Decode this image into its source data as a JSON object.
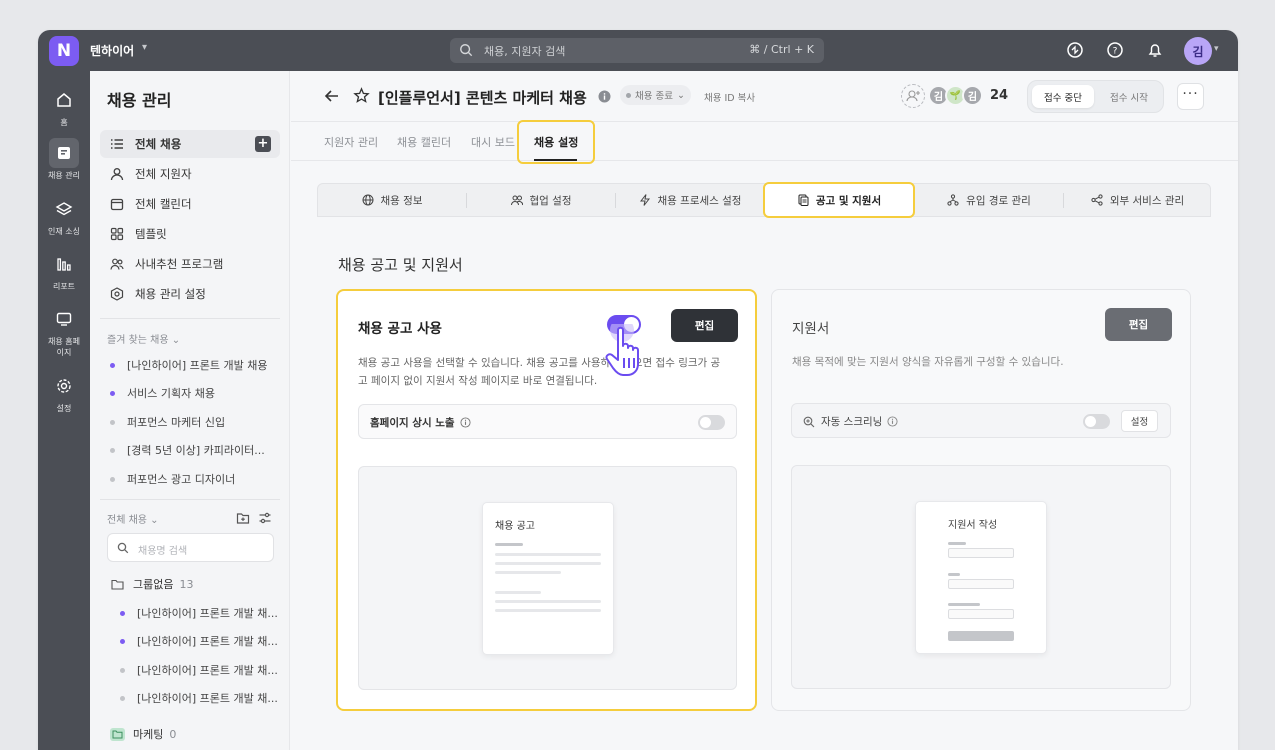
{
  "app": {
    "workspace": "텐하이어",
    "logo_letter": "N"
  },
  "search": {
    "placeholder": "채용, 지원자 검색",
    "shortcut": "⌘ / Ctrl + K"
  },
  "user": {
    "avatar": "김"
  },
  "rail": [
    {
      "label": "홈",
      "icon": "home-icon"
    },
    {
      "label": "채용 관리",
      "icon": "recruit-icon"
    },
    {
      "label": "인재 소싱",
      "icon": "layers-icon"
    },
    {
      "label": "리포트",
      "icon": "chart-icon"
    },
    {
      "label": "채용 홈페이지",
      "icon": "monitor-icon"
    },
    {
      "label": "설정",
      "icon": "gear-icon"
    }
  ],
  "sidebar": {
    "title": "채용 관리",
    "items": [
      {
        "label": "전체 채용"
      },
      {
        "label": "전체 지원자"
      },
      {
        "label": "전체 캘린더"
      },
      {
        "label": "템플릿"
      },
      {
        "label": "사내추천 프로그램"
      },
      {
        "label": "채용 관리 설정"
      }
    ],
    "favorites_title": "즐겨 찾는 채용",
    "favorites": [
      {
        "label": "[나인하이어] 프론트 개발 채용",
        "color": "#7c5cf2"
      },
      {
        "label": "서비스 기획자 채용",
        "color": "#7c5cf2"
      },
      {
        "label": "퍼포먼스 마케터 신입",
        "color": "#c2c4c8"
      },
      {
        "label": "[경력 5년 이상] 카피라이터...",
        "color": "#c2c4c8"
      },
      {
        "label": "퍼포먼스 광고 디자이너",
        "color": "#c2c4c8"
      }
    ],
    "all_title": "전체 채용",
    "search_placeholder": "채용명 검색",
    "group_none": {
      "label": "그룹없음",
      "count": "13"
    },
    "group_items": [
      {
        "label": "[나인하이어] 프론트 개발 채...",
        "color": "#7c5cf2"
      },
      {
        "label": "[나인하이어] 프론트 개발 채...",
        "color": "#7c5cf2"
      },
      {
        "label": "[나인하이어] 프론트 개발 채...",
        "color": "#c2c4c8"
      },
      {
        "label": "[나인하이어] 프론트 개발 채...",
        "color": "#c2c4c8"
      }
    ],
    "group_marketing": {
      "label": "마케팅",
      "count": "0"
    }
  },
  "header": {
    "title": "[인플루언서] 콘텐츠 마케터 채용",
    "status": "채용 종료",
    "copy_id": "채용 ID 복사",
    "avatars": [
      "김",
      "🌱",
      "김"
    ],
    "count": "24",
    "seg_on": "접수 중단",
    "seg_off": "접수 시작",
    "more": "···"
  },
  "tabs": [
    "지원자 관리",
    "채용 캘린더",
    "대시 보드",
    "채용 설정"
  ],
  "subtabs": [
    {
      "label": "채용 정보"
    },
    {
      "label": "협업 설정"
    },
    {
      "label": "채용 프로세스 설정"
    },
    {
      "label": "공고 및 지원서"
    },
    {
      "label": "유입 경로 관리"
    },
    {
      "label": "외부 서비스 관리"
    }
  ],
  "section_title": "채용 공고 및 지원서",
  "posting_card": {
    "title": "채용 공고 사용",
    "edit": "편집",
    "desc_line1": "채용 공고 사용을 선택할 수 있습니다. 채용 공고를 사용하지 않으면 접수 링크가 공",
    "desc_line2": "고 페이지 없이 지원서 작성 페이지로 바로 연결됩니다.",
    "row_label": "홈페이지 상시 노출",
    "preview_title": "채용 공고",
    "toggle_on": true
  },
  "form_card": {
    "title": "지원서",
    "edit": "편집",
    "desc": "채용 목적에 맞는 지원서 양식을 자유롭게 구성할 수 있습니다.",
    "row_label": "자동 스크리닝",
    "row_button": "설정",
    "preview_title": "지원서 작성"
  },
  "colors": {
    "accent": "#6b4cf0",
    "highlight": "#f5cd3d",
    "dark": "#2f3237"
  }
}
